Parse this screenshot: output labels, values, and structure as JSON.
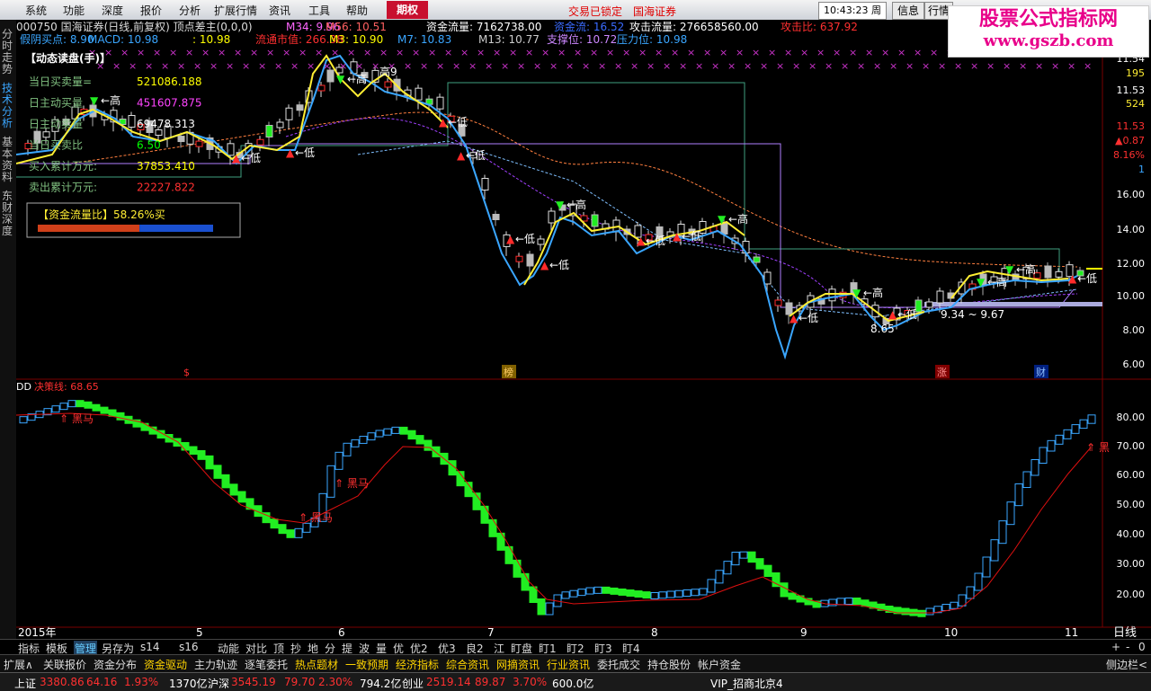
{
  "menu": [
    "系统",
    "功能",
    "深度",
    "报价",
    "分析",
    "扩展行情",
    "资讯",
    "工具",
    "帮助"
  ],
  "menu_highlight": "期权",
  "top_status": [
    "交易已锁定",
    "国海证券"
  ],
  "clock": "10:43:23",
  "weekday": "周三",
  "top_buttons": [
    "信息",
    "行情"
  ],
  "watermark": {
    "line1": "股票公式指标网",
    "line2": "www.gszb.com"
  },
  "side_tabs": [
    "分时走势",
    "技术分析",
    "基本资料",
    "东财深度"
  ],
  "header": {
    "row1": [
      {
        "t": "000750 国海证券(日线,前复权) 顶点差主(0,0,0)",
        "c": "#dddddd"
      },
      {
        "t": "M34: 9.96",
        "c": "#ff66ff"
      },
      {
        "t": "M56: 10.51",
        "c": "#ff6060"
      },
      {
        "t": "资金流量: 7162738.00",
        "c": "#ffffff"
      },
      {
        "t": "资金流: 16.52",
        "c": "#3a6bff"
      },
      {
        "t": "攻击流量: 276658560.00",
        "c": "#ffffff"
      },
      {
        "t": "攻击比: 637.92",
        "c": "#ff3030"
      }
    ],
    "row2": [
      {
        "t": "假阴买点: 8.90",
        "c": "#3aa6ff"
      },
      {
        "t": "MACD: 10.98",
        "c": "#3aa6ff"
      },
      {
        "t": ": 10.98",
        "c": "#ffff00"
      },
      {
        "t": "流通市值: 266.38",
        "c": "#ff3030"
      },
      {
        "t": "M3: 10.90",
        "c": "#ffff00"
      },
      {
        "t": "M7: 10.83",
        "c": "#3aa6ff"
      },
      {
        "t": "M13: 10.77",
        "c": "#cccccc"
      },
      {
        "t": "支撑位: 10.72",
        "c": "#cc88ff"
      },
      {
        "t": "压力位: 10.98",
        "c": "#3aa6ff"
      }
    ]
  },
  "dynamic_panel": {
    "title": "【动态读盘(手)】",
    "rows": [
      {
        "label": "当日买卖量=",
        "value": "521086.188",
        "vc": "#ffff00"
      },
      {
        "label": "日主动买量",
        "value": "451607.875",
        "vc": "#ff44ff"
      },
      {
        "label": "日主动卖量",
        "value": "69478.313",
        "vc": "#ffffff"
      },
      {
        "label": "当日买卖比",
        "value": "6.50",
        "vc": "#00ff00"
      },
      {
        "label": "买入累计万元:",
        "value": "37853.410",
        "vc": "#ffff00"
      },
      {
        "label": "卖出累计万元:",
        "value": "22227.822",
        "vc": "#ff3030"
      }
    ],
    "flow_label": "【资金流量比】58.26%买",
    "flow_ratio": 0.58
  },
  "price_axis": [
    "11.54",
    "195",
    "11.53",
    "524",
    "11.53",
    "▲0.87",
    "8.16%",
    "1",
    "16.00",
    "14.00",
    "12.00",
    "10.00",
    "8.00",
    "6.00"
  ],
  "event_markers": [
    "$",
    "榜",
    "涨",
    "财"
  ],
  "lower": {
    "title": "DD",
    "line_label": "决策线: 68.65",
    "axis": [
      "80.00",
      "70.00",
      "60.00",
      "50.00",
      "40.00",
      "30.00",
      "20.00"
    ],
    "marks": [
      "黑马",
      "黑马",
      "黑马",
      "黑马",
      "黑"
    ]
  },
  "time_axis": [
    "2015年",
    "5",
    "6",
    "7",
    "8",
    "9",
    "10",
    "11"
  ],
  "period": "日线",
  "chart_labels": {
    "high": "高",
    "low": "低",
    "high2": "高9",
    "range": "9.34 ~ 9.67",
    "low_val": "8.65"
  },
  "bottom_tabs": [
    "指标",
    "模板",
    "管理",
    "另存为",
    "s14",
    "s16",
    "动能",
    "对比",
    "顶",
    "抄",
    "地",
    "分",
    "提",
    "波",
    "量",
    "优",
    "优2",
    "优3",
    "良2",
    "江",
    "盯盘",
    "盯1",
    "盯2",
    "盯3",
    "盯4"
  ],
  "bottom_right": [
    "+",
    "-",
    "0"
  ],
  "func_bar": [
    "扩展∧",
    "关联报价",
    "资金分布",
    "资金驱动",
    "主力轨迹",
    "逐笔委托",
    "热点题材",
    "一致预期",
    "经济指标",
    "综合资讯",
    "网摘资讯",
    "行业资讯",
    "委托成交",
    "持仓股份",
    "帐户资金"
  ],
  "func_right": "侧边栏<",
  "status": [
    {
      "t": "上证",
      "c": "#ffffff"
    },
    {
      "t": "3380.86",
      "c": "#ff3030"
    },
    {
      "t": "64.16",
      "c": "#ff3030"
    },
    {
      "t": "1.93%",
      "c": "#ff3030"
    },
    {
      "t": "1370亿",
      "c": "#ffffff"
    },
    {
      "t": "沪深",
      "c": "#ffffff"
    },
    {
      "t": "3545.19",
      "c": "#ff3030"
    },
    {
      "t": "79.70",
      "c": "#ff3030"
    },
    {
      "t": "2.30%",
      "c": "#ff3030"
    },
    {
      "t": "794.2亿",
      "c": "#ffffff"
    },
    {
      "t": "创业",
      "c": "#ffffff"
    },
    {
      "t": "2519.14",
      "c": "#ff3030"
    },
    {
      "t": "89.87",
      "c": "#ff3030"
    },
    {
      "t": "3.70%",
      "c": "#ff3030"
    },
    {
      "t": "600.0亿",
      "c": "#ffffff"
    },
    {
      "t": "VIP_招商北京4",
      "c": "#ffffff"
    }
  ],
  "colors": {
    "up": "#ff2a2a",
    "down": "#32d8ff",
    "green": "#22ee22",
    "blue_bar": "#3aa6ff",
    "yellow": "#ffee33"
  }
}
